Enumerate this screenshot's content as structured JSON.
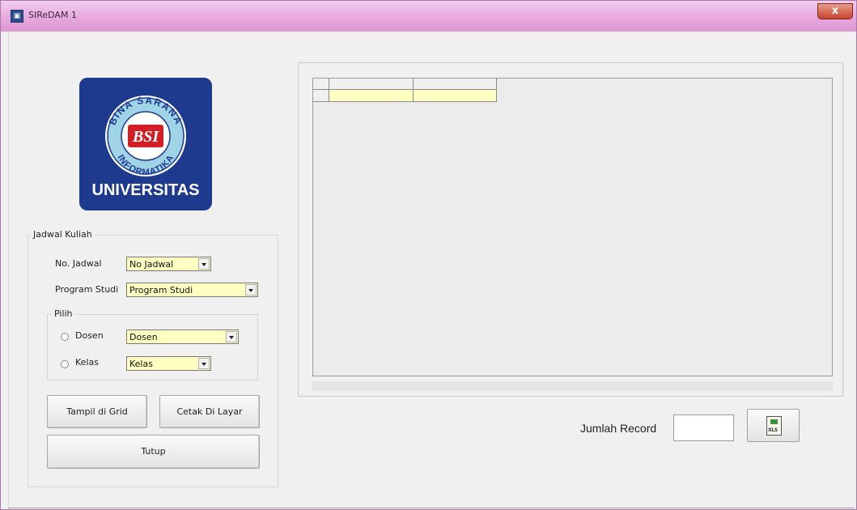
{
  "window": {
    "title": "SIReDAM 1",
    "close_label": "x"
  },
  "logo": {
    "arc_top": "BINA SARANA",
    "arc_bottom": "INFORMATIKA",
    "center": "BSI",
    "caption": "UNIVERSITAS"
  },
  "jadwal": {
    "legend": "Jadwal Kuliah",
    "no_jadwal_label": "No. Jadwal",
    "no_jadwal_value": "No Jadwal",
    "prodi_label": "Program Studi",
    "prodi_value": "Program Studi",
    "pilih": {
      "legend": "Pilih",
      "dosen_label": "Dosen",
      "dosen_value": "Dosen",
      "kelas_label": "Kelas",
      "kelas_value": "Kelas"
    },
    "tampil_button": "Tampil di Grid",
    "cetak_button": "Cetak Di Layar",
    "tutup_button": "Tutup"
  },
  "record": {
    "label": "Jumlah Record",
    "value": "",
    "export_icon_text": "XLS"
  }
}
